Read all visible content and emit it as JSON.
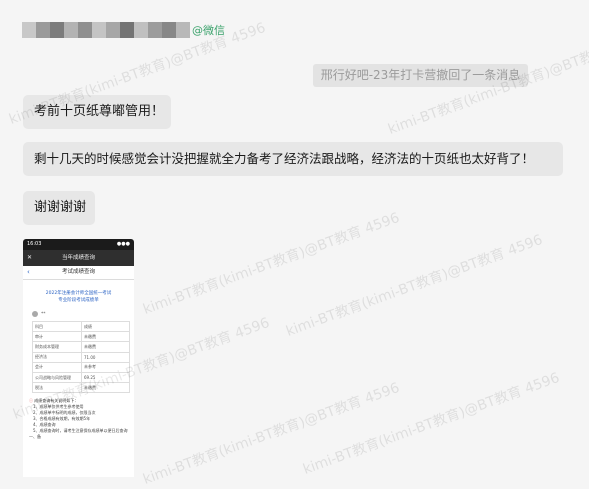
{
  "header": {
    "blurred_name_colors": [
      "#c8c8c8",
      "#9a9a9a",
      "#7c7c7c",
      "#b3b3b3",
      "#8f8f8f",
      "#c4c4c4",
      "#a6a6a6",
      "#747474",
      "#c0c0c0",
      "#9c9c9c",
      "#878787",
      "#b8b8b8"
    ],
    "name_suffix": "@微信"
  },
  "notice": {
    "text": "邢行好吧-23年打卡营撤回了一条消息"
  },
  "messages": [
    {
      "text": "考前十页纸尊嘟管用！"
    },
    {
      "text": "剩十几天的时候感觉会计没把握就全力备考了经济法跟战略，经济法的十页纸也太好背了！"
    },
    {
      "text": "谢谢谢谢"
    }
  ],
  "phone_screenshot": {
    "status_time": "16:03",
    "status_right": "●●●",
    "top_title": "当年成绩查询",
    "close_glyph": "✕",
    "nav_title": "考试成绩查询",
    "back_glyph": "‹",
    "heading_line1": "2022年注册会计师全国统一考试",
    "heading_line2": "专业阶段考试成绩单",
    "person_name": "**",
    "table": [
      {
        "subject": "科目",
        "result": "成绩"
      },
      {
        "subject": "审计",
        "result": "未缴费"
      },
      {
        "subject": "财务成本管理",
        "result": "未缴费"
      },
      {
        "subject": "经济法",
        "result": "71.00"
      },
      {
        "subject": "会计",
        "result": "未参考"
      },
      {
        "subject": "公司战略与风险管理",
        "result": "69.25"
      },
      {
        "subject": "税法",
        "result": "未缴费"
      }
    ],
    "notes_head": "成绩查询有关说明如下：",
    "notes": [
      "1、成绩单仅供考生参考使用",
      "2、成绩单中标明的成绩，仅限当次",
      "3、合格成绩有效期，有效期5年",
      "4、成绩查询",
      "5、成绩查询时，请考生注意保存成绩单以便日后查询"
    ],
    "notes_tail": "一、备"
  },
  "watermark": {
    "text": "kimi-BT教育(kimi-BT教育)@BT教育 4596"
  }
}
